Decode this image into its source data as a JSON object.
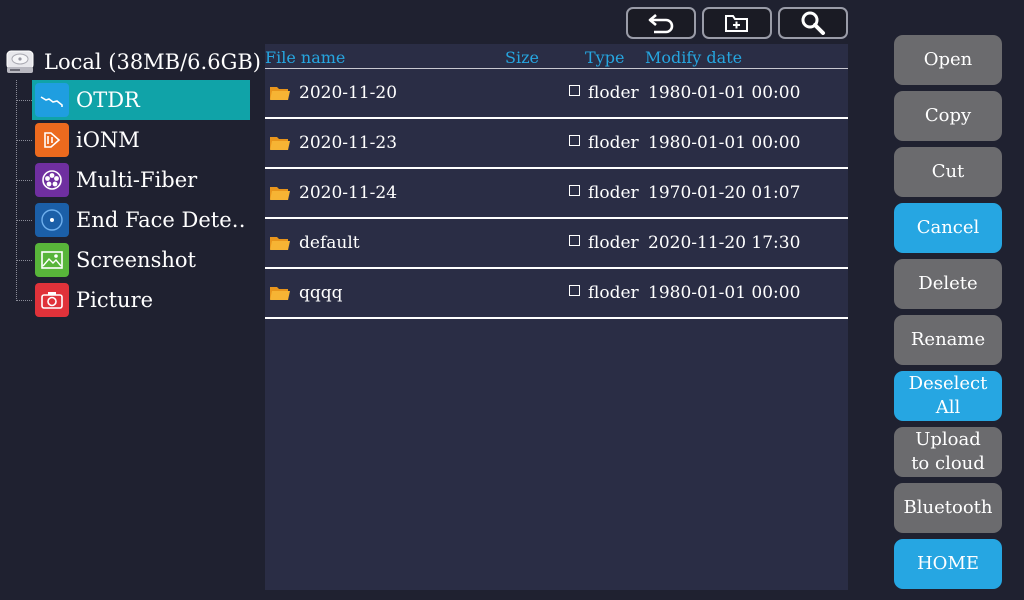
{
  "toolbar": {
    "buttons": [
      {
        "name": "back-button",
        "icon": "back-arrow-icon"
      },
      {
        "name": "new-folder-button",
        "icon": "new-folder-icon"
      },
      {
        "name": "search-button",
        "icon": "search-icon"
      }
    ]
  },
  "tree": {
    "root_label": "Local (38MB/6.6GB)",
    "root_icon": "hard-drive-icon",
    "items": [
      {
        "label": "OTDR",
        "icon": "otdr-icon",
        "color": "#1f9ee0",
        "selected": true
      },
      {
        "label": "iONM",
        "icon": "ionm-icon",
        "color": "#ec6a1e",
        "selected": false
      },
      {
        "label": "Multi-Fiber",
        "icon": "multi-fiber-icon",
        "color": "#6f2fa0",
        "selected": false
      },
      {
        "label": "End Face Dete…",
        "icon": "end-face-icon",
        "color": "#1b5fa8",
        "selected": false
      },
      {
        "label": "Screenshot",
        "icon": "screenshot-icon",
        "color": "#58b53a",
        "selected": false
      },
      {
        "label": "Picture",
        "icon": "picture-icon",
        "color": "#e0323a",
        "selected": false
      }
    ]
  },
  "table": {
    "headers": {
      "name": "File name",
      "size": "Size",
      "type": "Type",
      "date": "Modify date"
    },
    "rows": [
      {
        "name": "2020-11-20",
        "type": "floder",
        "date": "1980-01-01 00:00"
      },
      {
        "name": "2020-11-23",
        "type": "floder",
        "date": "1980-01-01 00:00"
      },
      {
        "name": "2020-11-24",
        "type": "floder",
        "date": "1970-01-20 01:07"
      },
      {
        "name": "default",
        "type": "floder",
        "date": "2020-11-20 17:30"
      },
      {
        "name": "qqqq",
        "type": "floder",
        "date": "1980-01-01 00:00"
      }
    ]
  },
  "side_buttons": {
    "open": "Open",
    "copy": "Copy",
    "cut": "Cut",
    "cancel": "Cancel",
    "delete": "Delete",
    "rename": "Rename",
    "deselect_line1": "Deselect",
    "deselect_line2": "All",
    "upload_line1": "Upload",
    "upload_line2": "to cloud",
    "bluetooth": "Bluetooth",
    "home": "HOME"
  },
  "colors": {
    "background": "#1f2130",
    "panel": "#2a2d45",
    "accent_blue": "#26a6e2",
    "selection_teal": "#10a3a8",
    "button_gray": "#6b6b6e",
    "header_text": "#26a6e0",
    "folder_yellow": "#f2a82a"
  }
}
